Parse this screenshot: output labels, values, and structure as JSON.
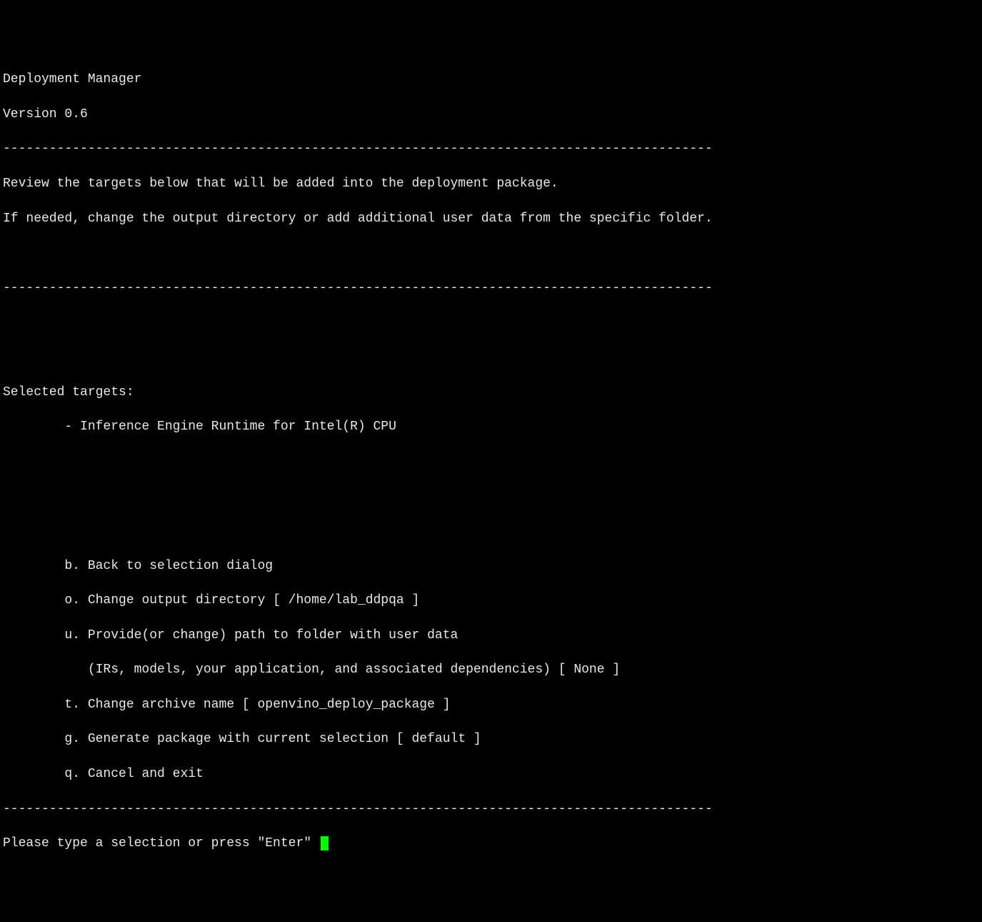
{
  "header": {
    "title": "Deployment Manager",
    "version": "Version 0.6"
  },
  "divider": "--------------------------------------------------------------------------------------------",
  "intro": {
    "line1": "Review the targets below that will be added into the deployment package.",
    "line2": "If needed, change the output directory or add additional user data from the specific folder."
  },
  "selected": {
    "heading": "Selected targets:",
    "items": [
      {
        "label": "        - Inference Engine Runtime for Intel(R) CPU"
      }
    ]
  },
  "options": {
    "b": {
      "key": "        b.",
      "text": " Back to selection dialog"
    },
    "o": {
      "key": "        o.",
      "text": " Change output directory [ /home/lab_ddpqa ]"
    },
    "u": {
      "key": "        u.",
      "text": " Provide(or change) path to folder with user data",
      "sub": "           (IRs, models, your application, and associated dependencies) [ None ]"
    },
    "t": {
      "key": "        t.",
      "text": " Change archive name [ openvino_deploy_package ]"
    },
    "g": {
      "key": "        g.",
      "text": " Generate package with current selection [ default ]"
    },
    "q": {
      "key": "        q.",
      "text": " Cancel and exit"
    }
  },
  "prompt": "Please type a selection or press \"Enter\" "
}
